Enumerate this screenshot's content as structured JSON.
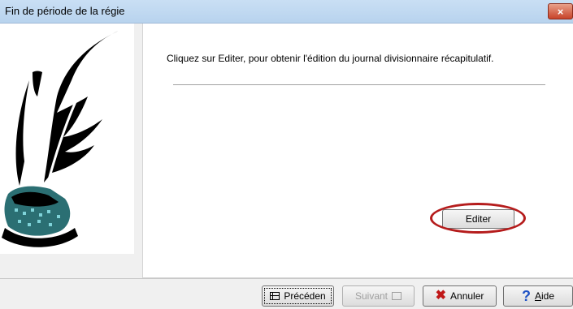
{
  "window": {
    "title": "Fin de période de la régie",
    "close_symbol": "×"
  },
  "main": {
    "instruction": "Cliquez sur Editer, pour obtenir l'édition du journal divisionnaire récapitulatif.",
    "edit_button_label": "Editer"
  },
  "footer": {
    "prev_label": "Précéden",
    "next_label": "Suivant",
    "cancel_label": "Annuler",
    "help_label_first": "A",
    "help_label_rest": "ide"
  },
  "colors": {
    "highlight": "#b51c1c",
    "help_icon": "#1f52c4",
    "cancel_icon": "#c01818"
  },
  "icons": {
    "prev": "table-icon",
    "next": "table-icon",
    "cancel": "red-x-icon",
    "help": "question-mark-icon",
    "illustration": "quill-and-inkwell-icon"
  }
}
